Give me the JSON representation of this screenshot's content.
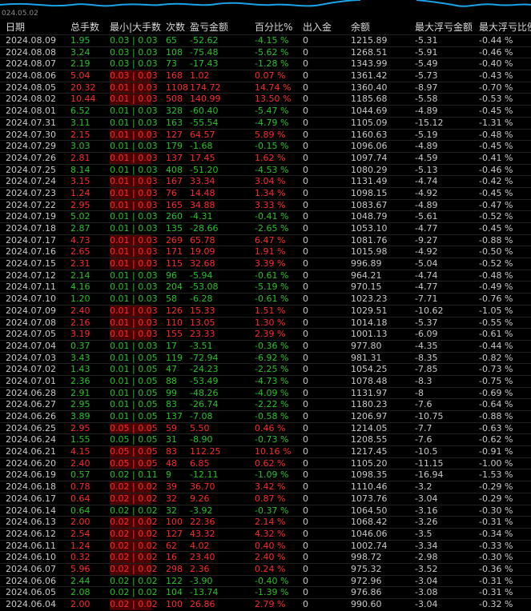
{
  "strip": {
    "date": "024.05.02"
  },
  "headers": [
    "日期",
    "总手数",
    "最小|大手数",
    "次数",
    "盈亏金额",
    "百分比%",
    "出入金",
    "余额",
    "最大浮亏金额",
    "最大浮亏比例"
  ],
  "colors": {
    "gain": "#27c127",
    "loss": "#ff2a2a",
    "loss_bg": "#5a0000",
    "text": "#c8c8c8"
  },
  "rows": [
    {
      "d": "2024.08.09",
      "lots": "1.95",
      "mm": "0.03 | 0.03",
      "n": "65",
      "pl": "-52.62",
      "pct": "-4.15 %",
      "io": "0",
      "bal": "1215.89",
      "mfl": "-5.31",
      "mfp": "-0.44 %",
      "loss": true
    },
    {
      "d": "2024.08.08",
      "lots": "3.24",
      "mm": "0.03 | 0.03",
      "n": "108",
      "pl": "-75.48",
      "pct": "-5.62 %",
      "io": "0",
      "bal": "1268.51",
      "mfl": "-5.91",
      "mfp": "-0.46 %",
      "loss": true
    },
    {
      "d": "2024.08.07",
      "lots": "2.19",
      "mm": "0.03 | 0.03",
      "n": "73",
      "pl": "-17.43",
      "pct": "-1.28 %",
      "io": "0",
      "bal": "1343.99",
      "mfl": "-5.49",
      "mfp": "-0.40 %",
      "loss": true
    },
    {
      "d": "2024.08.06",
      "lots": "5.04",
      "mm": "0.03 | 0.03",
      "n": "168",
      "pl": "1.02",
      "pct": "0.07 %",
      "io": "0",
      "bal": "1361.42",
      "mfl": "-5.73",
      "mfp": "-0.43 %",
      "loss": false
    },
    {
      "d": "2024.08.05",
      "lots": "20.32",
      "mm": "0.01 | 0.03",
      "n": "1108",
      "pl": "174.72",
      "pct": "14.74 %",
      "io": "0",
      "bal": "1360.40",
      "mfl": "-8.97",
      "mfp": "-0.70 %",
      "loss": false
    },
    {
      "d": "2024.08.02",
      "lots": "10.44",
      "mm": "0.01 | 0.03",
      "n": "508",
      "pl": "140.99",
      "pct": "13.50 %",
      "io": "0",
      "bal": "1185.68",
      "mfl": "-5.58",
      "mfp": "-0.53 %",
      "loss": false
    },
    {
      "d": "2024.08.01",
      "lots": "6.52",
      "mm": "0.01 | 0.03",
      "n": "328",
      "pl": "-60.40",
      "pct": "-5.47 %",
      "io": "0",
      "bal": "1044.69",
      "mfl": "-4.89",
      "mfp": "-0.45 %",
      "loss": true
    },
    {
      "d": "2024.07.31",
      "lots": "3.11",
      "mm": "0.01 | 0.03",
      "n": "163",
      "pl": "-55.54",
      "pct": "-4.79 %",
      "io": "0",
      "bal": "1105.09",
      "mfl": "-15.12",
      "mfp": "-1.31 %",
      "loss": true
    },
    {
      "d": "2024.07.30",
      "lots": "2.15",
      "mm": "0.01 | 0.03",
      "n": "127",
      "pl": "64.57",
      "pct": "5.89 %",
      "io": "0",
      "bal": "1160.63",
      "mfl": "-5.19",
      "mfp": "-0.48 %",
      "loss": false
    },
    {
      "d": "2024.07.29",
      "lots": "3.03",
      "mm": "0.01 | 0.03",
      "n": "179",
      "pl": "-1.68",
      "pct": "-0.15 %",
      "io": "0",
      "bal": "1096.06",
      "mfl": "-4.89",
      "mfp": "-0.45 %",
      "loss": true
    },
    {
      "d": "2024.07.26",
      "lots": "2.81",
      "mm": "0.01 | 0.03",
      "n": "137",
      "pl": "17.45",
      "pct": "1.62 %",
      "io": "0",
      "bal": "1097.74",
      "mfl": "-4.59",
      "mfp": "-0.41 %",
      "loss": false
    },
    {
      "d": "2024.07.25",
      "lots": "8.14",
      "mm": "0.01 | 0.03",
      "n": "408",
      "pl": "-51.20",
      "pct": "-4.53 %",
      "io": "0",
      "bal": "1080.29",
      "mfl": "-5.13",
      "mfp": "-0.46 %",
      "loss": true
    },
    {
      "d": "2024.07.24",
      "lots": "3.15",
      "mm": "0.01 | 0.03",
      "n": "167",
      "pl": "33.34",
      "pct": "3.04 %",
      "io": "0",
      "bal": "1131.49",
      "mfl": "-4.74",
      "mfp": "-0.42 %",
      "loss": false
    },
    {
      "d": "2024.07.23",
      "lots": "1.24",
      "mm": "0.01 | 0.03",
      "n": "76",
      "pl": "14.48",
      "pct": "1.34 %",
      "io": "0",
      "bal": "1098.15",
      "mfl": "-4.92",
      "mfp": "-0.45 %",
      "loss": false
    },
    {
      "d": "2024.07.22",
      "lots": "2.95",
      "mm": "0.01 | 0.03",
      "n": "165",
      "pl": "34.88",
      "pct": "3.33 %",
      "io": "0",
      "bal": "1083.67",
      "mfl": "-4.89",
      "mfp": "-0.47 %",
      "loss": false
    },
    {
      "d": "2024.07.19",
      "lots": "5.02",
      "mm": "0.01 | 0.03",
      "n": "260",
      "pl": "-4.31",
      "pct": "-0.41 %",
      "io": "0",
      "bal": "1048.79",
      "mfl": "-5.61",
      "mfp": "-0.52 %",
      "loss": true
    },
    {
      "d": "2024.07.18",
      "lots": "2.87",
      "mm": "0.01 | 0.03",
      "n": "135",
      "pl": "-28.66",
      "pct": "-2.65 %",
      "io": "0",
      "bal": "1053.10",
      "mfl": "-4.77",
      "mfp": "-0.45 %",
      "loss": true
    },
    {
      "d": "2024.07.17",
      "lots": "4.73",
      "mm": "0.01 | 0.03",
      "n": "269",
      "pl": "65.78",
      "pct": "6.47 %",
      "io": "0",
      "bal": "1081.76",
      "mfl": "-9.27",
      "mfp": "-0.88 %",
      "loss": false
    },
    {
      "d": "2024.07.16",
      "lots": "2.65",
      "mm": "0.01 | 0.03",
      "n": "171",
      "pl": "19.09",
      "pct": "1.91 %",
      "io": "0",
      "bal": "1015.98",
      "mfl": "-4.92",
      "mfp": "-0.50 %",
      "loss": false
    },
    {
      "d": "2024.07.15",
      "lots": "2.31",
      "mm": "0.01 | 0.03",
      "n": "115",
      "pl": "32.68",
      "pct": "3.39 %",
      "io": "0",
      "bal": "996.89",
      "mfl": "-5.04",
      "mfp": "-0.52 %",
      "loss": false
    },
    {
      "d": "2024.07.12",
      "lots": "2.14",
      "mm": "0.01 | 0.03",
      "n": "96",
      "pl": "-5.94",
      "pct": "-0.61 %",
      "io": "0",
      "bal": "964.21",
      "mfl": "-4.74",
      "mfp": "-0.48 %",
      "loss": true
    },
    {
      "d": "2024.07.11",
      "lots": "4.16",
      "mm": "0.01 | 0.03",
      "n": "204",
      "pl": "-53.08",
      "pct": "-5.19 %",
      "io": "0",
      "bal": "970.15",
      "mfl": "-4.77",
      "mfp": "-0.49 %",
      "loss": true
    },
    {
      "d": "2024.07.10",
      "lots": "1.20",
      "mm": "0.01 | 0.03",
      "n": "58",
      "pl": "-6.28",
      "pct": "-0.61 %",
      "io": "0",
      "bal": "1023.23",
      "mfl": "-7.71",
      "mfp": "-0.76 %",
      "loss": true
    },
    {
      "d": "2024.07.09",
      "lots": "2.40",
      "mm": "0.01 | 0.03",
      "n": "126",
      "pl": "15.33",
      "pct": "1.51 %",
      "io": "0",
      "bal": "1029.51",
      "mfl": "-10.62",
      "mfp": "-1.05 %",
      "loss": false
    },
    {
      "d": "2024.07.08",
      "lots": "2.16",
      "mm": "0.01 | 0.03",
      "n": "110",
      "pl": "13.05",
      "pct": "1.30 %",
      "io": "0",
      "bal": "1014.18",
      "mfl": "-5.37",
      "mfp": "-0.55 %",
      "loss": false
    },
    {
      "d": "2024.07.05",
      "lots": "3.19",
      "mm": "0.01 | 0.03",
      "n": "155",
      "pl": "23.33",
      "pct": "2.39 %",
      "io": "0",
      "bal": "1001.13",
      "mfl": "-6.09",
      "mfp": "-0.61 %",
      "loss": false
    },
    {
      "d": "2024.07.04",
      "lots": "0.37",
      "mm": "0.01 | 0.03",
      "n": "17",
      "pl": "-3.51",
      "pct": "-0.36 %",
      "io": "0",
      "bal": "977.80",
      "mfl": "-4.35",
      "mfp": "-0.44 %",
      "loss": true
    },
    {
      "d": "2024.07.03",
      "lots": "3.43",
      "mm": "0.01 | 0.05",
      "n": "119",
      "pl": "-72.94",
      "pct": "-6.92 %",
      "io": "0",
      "bal": "981.31",
      "mfl": "-8.35",
      "mfp": "-0.82 %",
      "loss": true
    },
    {
      "d": "2024.07.02",
      "lots": "1.43",
      "mm": "0.01 | 0.05",
      "n": "47",
      "pl": "-24.23",
      "pct": "-2.25 %",
      "io": "0",
      "bal": "1054.25",
      "mfl": "-7.85",
      "mfp": "-0.73 %",
      "loss": true
    },
    {
      "d": "2024.07.01",
      "lots": "2.36",
      "mm": "0.01 | 0.05",
      "n": "88",
      "pl": "-53.49",
      "pct": "-4.73 %",
      "io": "0",
      "bal": "1078.48",
      "mfl": "-8.3",
      "mfp": "-0.75 %",
      "loss": true
    },
    {
      "d": "2024.06.28",
      "lots": "2.91",
      "mm": "0.01 | 0.05",
      "n": "99",
      "pl": "-48.26",
      "pct": "-4.09 %",
      "io": "0",
      "bal": "1131.97",
      "mfl": "-8",
      "mfp": "-0.69 %",
      "loss": true
    },
    {
      "d": "2024.06.27",
      "lots": "2.95",
      "mm": "0.01 | 0.05",
      "n": "83",
      "pl": "-26.74",
      "pct": "-2.22 %",
      "io": "0",
      "bal": "1180.23",
      "mfl": "-7.6",
      "mfp": "-0.64 %",
      "loss": true
    },
    {
      "d": "2024.06.26",
      "lots": "3.89",
      "mm": "0.01 | 0.05",
      "n": "137",
      "pl": "-7.08",
      "pct": "-0.58 %",
      "io": "0",
      "bal": "1206.97",
      "mfl": "-10.75",
      "mfp": "-0.88 %",
      "loss": true
    },
    {
      "d": "2024.06.25",
      "lots": "2.95",
      "mm": "0.05 | 0.05",
      "n": "59",
      "pl": "5.50",
      "pct": "0.46 %",
      "io": "0",
      "bal": "1214.05",
      "mfl": "-7.7",
      "mfp": "-0.63 %",
      "loss": false
    },
    {
      "d": "2024.06.24",
      "lots": "1.55",
      "mm": "0.05 | 0.05",
      "n": "31",
      "pl": "-8.90",
      "pct": "-0.73 %",
      "io": "0",
      "bal": "1208.55",
      "mfl": "-7.6",
      "mfp": "-0.62 %",
      "loss": true
    },
    {
      "d": "2024.06.21",
      "lots": "4.15",
      "mm": "0.05 | 0.05",
      "n": "83",
      "pl": "112.25",
      "pct": "10.16 %",
      "io": "0",
      "bal": "1217.45",
      "mfl": "-10.5",
      "mfp": "-0.91 %",
      "loss": false
    },
    {
      "d": "2024.06.20",
      "lots": "2.40",
      "mm": "0.05 | 0.05",
      "n": "48",
      "pl": "6.85",
      "pct": "0.62 %",
      "io": "0",
      "bal": "1105.20",
      "mfl": "-11.15",
      "mfp": "-1.00 %",
      "loss": false
    },
    {
      "d": "2024.06.19",
      "lots": "0.57",
      "mm": "0.02 | 0.11",
      "n": "9",
      "pl": "-12.11",
      "pct": "-1.09 %",
      "io": "0",
      "bal": "1098.35",
      "mfl": "-16.94",
      "mfp": "-1.53 %",
      "loss": true
    },
    {
      "d": "2024.06.18",
      "lots": "0.78",
      "mm": "0.02 | 0.02",
      "n": "39",
      "pl": "36.70",
      "pct": "3.42 %",
      "io": "0",
      "bal": "1110.46",
      "mfl": "-3.2",
      "mfp": "-0.29 %",
      "loss": false
    },
    {
      "d": "2024.06.17",
      "lots": "0.64",
      "mm": "0.02 | 0.02",
      "n": "32",
      "pl": "9.26",
      "pct": "0.87 %",
      "io": "0",
      "bal": "1073.76",
      "mfl": "-3.04",
      "mfp": "-0.29 %",
      "loss": false
    },
    {
      "d": "2024.06.14",
      "lots": "0.64",
      "mm": "0.02 | 0.02",
      "n": "32",
      "pl": "-3.92",
      "pct": "-0.37 %",
      "io": "0",
      "bal": "1064.50",
      "mfl": "-3.16",
      "mfp": "-0.30 %",
      "loss": true
    },
    {
      "d": "2024.06.13",
      "lots": "2.00",
      "mm": "0.02 | 0.02",
      "n": "100",
      "pl": "22.36",
      "pct": "2.14 %",
      "io": "0",
      "bal": "1068.42",
      "mfl": "-3.26",
      "mfp": "-0.31 %",
      "loss": false
    },
    {
      "d": "2024.06.12",
      "lots": "2.54",
      "mm": "0.02 | 0.02",
      "n": "127",
      "pl": "43.32",
      "pct": "4.32 %",
      "io": "0",
      "bal": "1046.06",
      "mfl": "-3.5",
      "mfp": "-0.34 %",
      "loss": false
    },
    {
      "d": "2024.06.11",
      "lots": "1.24",
      "mm": "0.02 | 0.02",
      "n": "62",
      "pl": "4.02",
      "pct": "0.40 %",
      "io": "0",
      "bal": "1002.74",
      "mfl": "-3.34",
      "mfp": "-0.33 %",
      "loss": false
    },
    {
      "d": "2024.06.10",
      "lots": "0.32",
      "mm": "0.02 | 0.02",
      "n": "16",
      "pl": "23.40",
      "pct": "2.40 %",
      "io": "0",
      "bal": "998.72",
      "mfl": "-2.98",
      "mfp": "-0.30 %",
      "loss": false
    },
    {
      "d": "2024.06.07",
      "lots": "5.96",
      "mm": "0.02 | 0.02",
      "n": "298",
      "pl": "2.36",
      "pct": "0.24 %",
      "io": "0",
      "bal": "975.32",
      "mfl": "-3.52",
      "mfp": "-0.36 %",
      "loss": false
    },
    {
      "d": "2024.06.06",
      "lots": "2.44",
      "mm": "0.02 | 0.02",
      "n": "122",
      "pl": "-3.90",
      "pct": "-0.40 %",
      "io": "0",
      "bal": "972.96",
      "mfl": "-3.04",
      "mfp": "-0.31 %",
      "loss": true
    },
    {
      "d": "2024.06.05",
      "lots": "2.08",
      "mm": "0.02 | 0.02",
      "n": "104",
      "pl": "-13.74",
      "pct": "-1.39 %",
      "io": "0",
      "bal": "976.86",
      "mfl": "-3.08",
      "mfp": "-0.31 %",
      "loss": true
    },
    {
      "d": "2024.06.04",
      "lots": "2.00",
      "mm": "0.02 | 0.02",
      "n": "100",
      "pl": "26.86",
      "pct": "2.79 %",
      "io": "0",
      "bal": "990.60",
      "mfl": "-3.04",
      "mfp": "-0.32 %",
      "loss": false
    }
  ]
}
